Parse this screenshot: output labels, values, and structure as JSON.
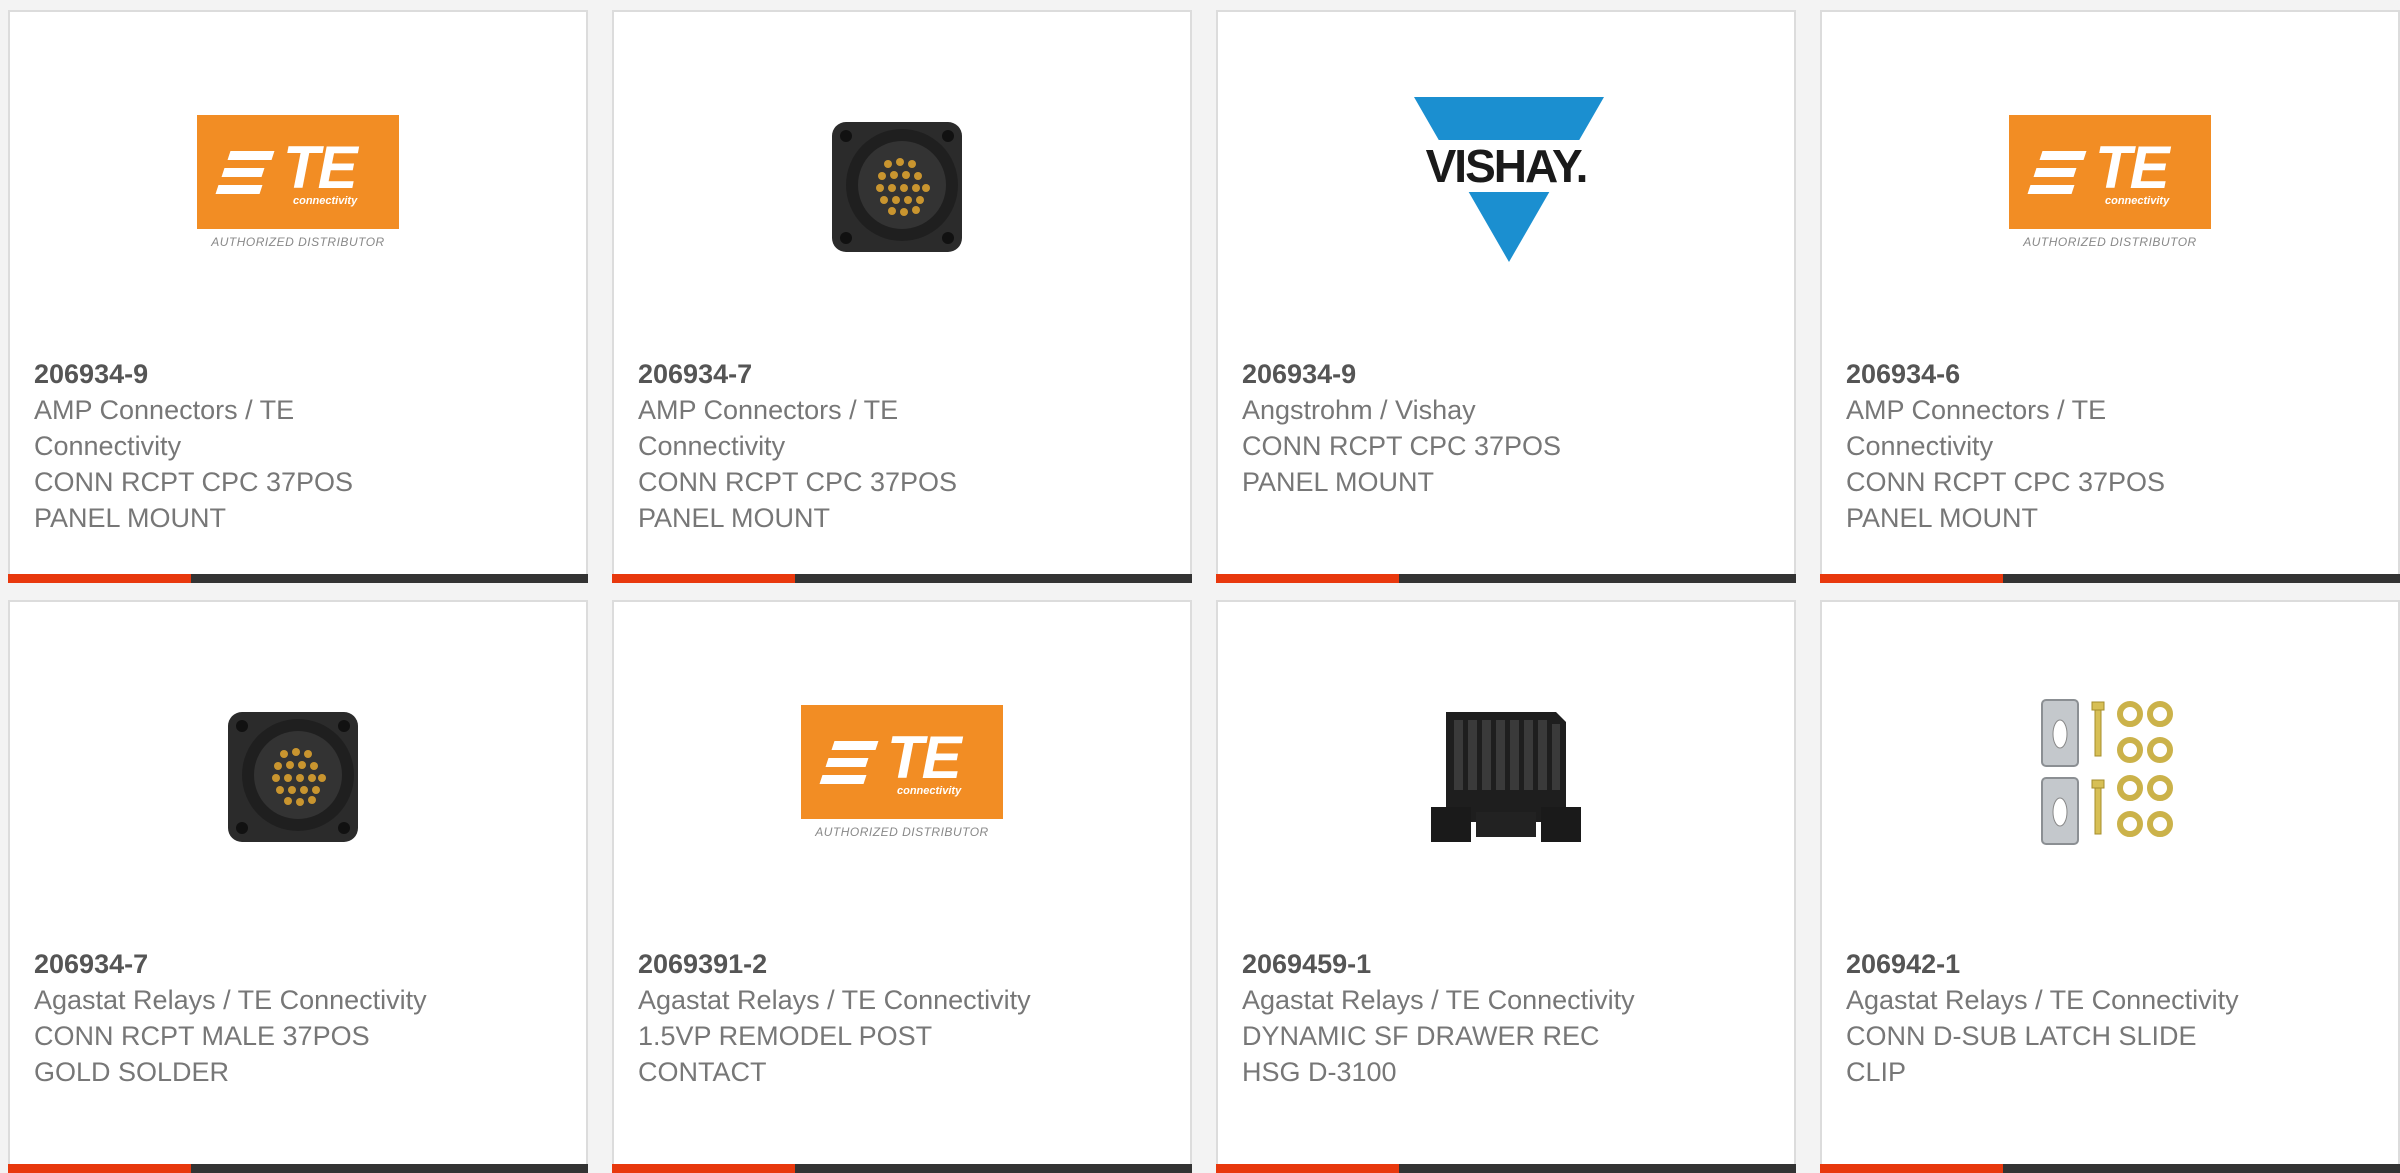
{
  "products": [
    {
      "part": "206934-9",
      "maker": "AMP Connectors / TE",
      "maker2": "Connectivity",
      "desc1": "CONN RCPT CPC 37POS",
      "desc2": "PANEL MOUNT",
      "image": "te-logo"
    },
    {
      "part": "206934-7",
      "maker": "AMP Connectors / TE",
      "maker2": "Connectivity",
      "desc1": "CONN RCPT CPC 37POS",
      "desc2": "PANEL MOUNT",
      "image": "circular-connector"
    },
    {
      "part": "206934-9",
      "maker": "Angstrohm / Vishay",
      "maker2": "",
      "desc1": "CONN RCPT CPC 37POS",
      "desc2": "PANEL MOUNT",
      "image": "vishay-logo"
    },
    {
      "part": "206934-6",
      "maker": "AMP Connectors / TE",
      "maker2": "Connectivity",
      "desc1": "CONN RCPT CPC 37POS",
      "desc2": "PANEL MOUNT",
      "image": "te-logo"
    },
    {
      "part": "206934-7",
      "maker": "Agastat Relays / TE Connectivity",
      "maker2": "",
      "desc1": "CONN RCPT MALE 37POS",
      "desc2": "GOLD SOLDER",
      "image": "circular-connector"
    },
    {
      "part": "2069391-2",
      "maker": "Agastat Relays / TE Connectivity",
      "maker2": "",
      "desc1": "1.5VP REMODEL POST",
      "desc2": "CONTACT",
      "image": "te-logo"
    },
    {
      "part": "2069459-1",
      "maker": "Agastat Relays / TE Connectivity",
      "maker2": "",
      "desc1": "DYNAMIC SF DRAWER REC",
      "desc2": "HSG D-3100",
      "image": "drawer-connector"
    },
    {
      "part": "206942-1",
      "maker": "Agastat Relays / TE Connectivity",
      "maker2": "",
      "desc1": "CONN D-SUB LATCH SLIDE",
      "desc2": "CLIP",
      "image": "latch-clip-kit"
    }
  ],
  "logos": {
    "te_word": "TE",
    "te_sub": "connectivity",
    "te_authorized": "AUTHORIZED DISTRIBUTOR",
    "vishay_word": "VISHAY."
  },
  "colors": {
    "accent": "#e8380d",
    "bar": "#333333",
    "te_orange": "#f28d24",
    "vishay_blue": "#1b8fd0"
  }
}
